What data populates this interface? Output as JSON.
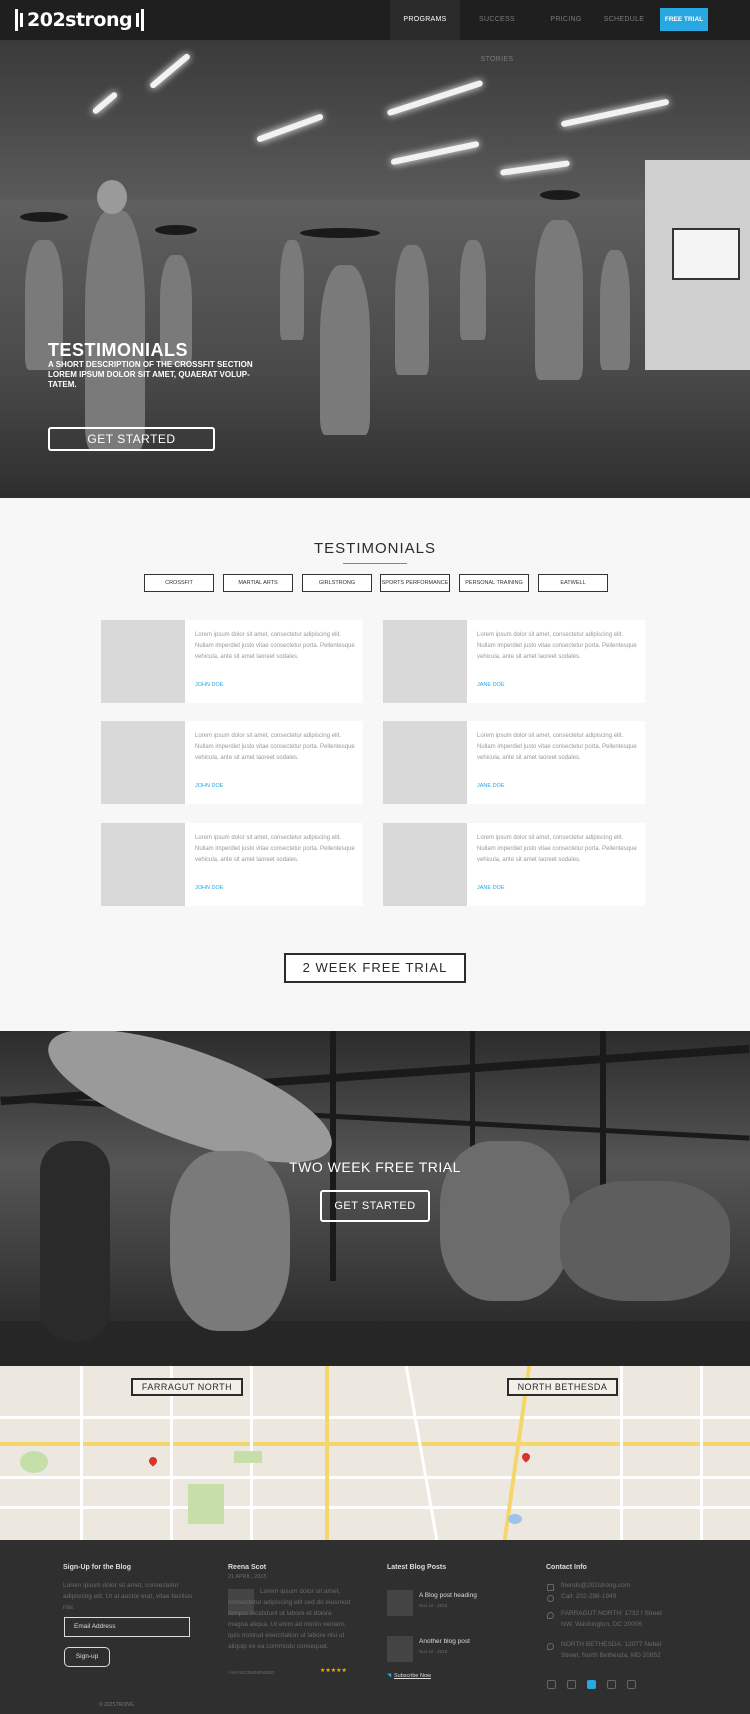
{
  "nav": {
    "logo": "202strong",
    "items": [
      "Programs",
      "Success Stories",
      "Pricing",
      "Schedule"
    ],
    "cta": "Free Trial"
  },
  "hero": {
    "title": "TESTIMONIALS",
    "subtitle": "A SHORT DESCRIPTION OF THE CROSSFIT SECTION LOREM IPSUM DOLOR SIT AMET, QUAERAT VOLUP-TATEM.",
    "button": "GET STARTED"
  },
  "testimonials": {
    "title": "TESTIMONIALS",
    "filters": [
      "Crossfit",
      "Martial Arts",
      "Girlstrong",
      "Sports Performance",
      "Personal Training",
      "Eatwell"
    ],
    "cards": [
      {
        "text": "Lorem ipsum dolor sit amet, consectetur adipiscing elit. Nullam imperdiet justo vitae consectetur porta. Pellentesque vehicula, ante sit amet laoreet sodales.",
        "author": "John Doe"
      },
      {
        "text": "Lorem ipsum dolor sit amet, consectetur adipiscing elit. Nullam imperdiet justo vitae consectetur porta. Pellentesque vehicula, ante sit amet laoreet sodales.",
        "author": "Jane Doe"
      },
      {
        "text": "Lorem ipsum dolor sit amet, consectetur adipiscing elit. Nullam imperdiet justo vitae consectetur porta. Pellentesque vehicula, ante sit amet laoreet sodales.",
        "author": "John Doe"
      },
      {
        "text": "Lorem ipsum dolor sit amet, consectetur adipiscing elit. Nullam imperdiet justo vitae consectetur porta. Pellentesque vehicula, ante sit amet laoreet sodales.",
        "author": "Jane Doe"
      },
      {
        "text": "Lorem ipsum dolor sit amet, consectetur adipiscing elit. Nullam imperdiet justo vitae consectetur porta. Pellentesque vehicula, ante sit amet laoreet sodales.",
        "author": "John Doe"
      },
      {
        "text": "Lorem ipsum dolor sit amet, consectetur adipiscing elit. Nullam imperdiet justo vitae consectetur porta. Pellentesque vehicula, ante sit amet laoreet sodales.",
        "author": "Jane Doe"
      }
    ],
    "trial_button": "2 WEEK FREE TRIAL"
  },
  "trial_band": {
    "title": "TWO WEEK FREE TRIAL",
    "button": "GET STARTED"
  },
  "map": {
    "labels": [
      "FARRAGUT NORTH",
      "NORTH BETHESDA"
    ]
  },
  "footer": {
    "signup": {
      "heading": "Sign-Up for the Blog",
      "text": "Lorem ipsum dolor sit amet, consectetur adipiscing elit. Ut at auctor erat, vitae facilisis nisi.",
      "placeholder": "Email Address",
      "button": "Sign-up"
    },
    "review": {
      "heading": "Reena Scot",
      "date": "21 APRIL, 2015",
      "text": "Lorem ipsum dolor sit amet, consectetur adipiscing elit sed do eiusmod tempor incididunt ut labore et dolore magna aliqua. Ut enim ad minim veniam, quis nostrud exercitation ut labore nisi ut aliquip ex ea commodo consequat.",
      "tag": "I AM RECOMMENDED",
      "stars": "★★★★★"
    },
    "blog": {
      "heading": "Latest Blog Posts",
      "posts": [
        {
          "title": "A Blog post heading",
          "date": "Nov 12 - 2015"
        },
        {
          "title": "Another blog post",
          "date": "Nov 12 - 2015"
        }
      ],
      "subscribe": "Subscribe Now"
    },
    "contact": {
      "heading": "Contact Info",
      "email": "friends@202strong.com",
      "phone": "Call: 202-296-1949",
      "addr1": "FARRAGUT NORTH: 1732 I Street NW, Washington, DC 20006",
      "addr2": "NORTH BETHESDA: 12077 Nebel Street, North Bethesda, MD 20852"
    },
    "copyright": "© 202STRONG"
  },
  "colors": {
    "accent": "#29a7e1",
    "dark": "#2f2f2f",
    "stars": "#f0b400"
  }
}
